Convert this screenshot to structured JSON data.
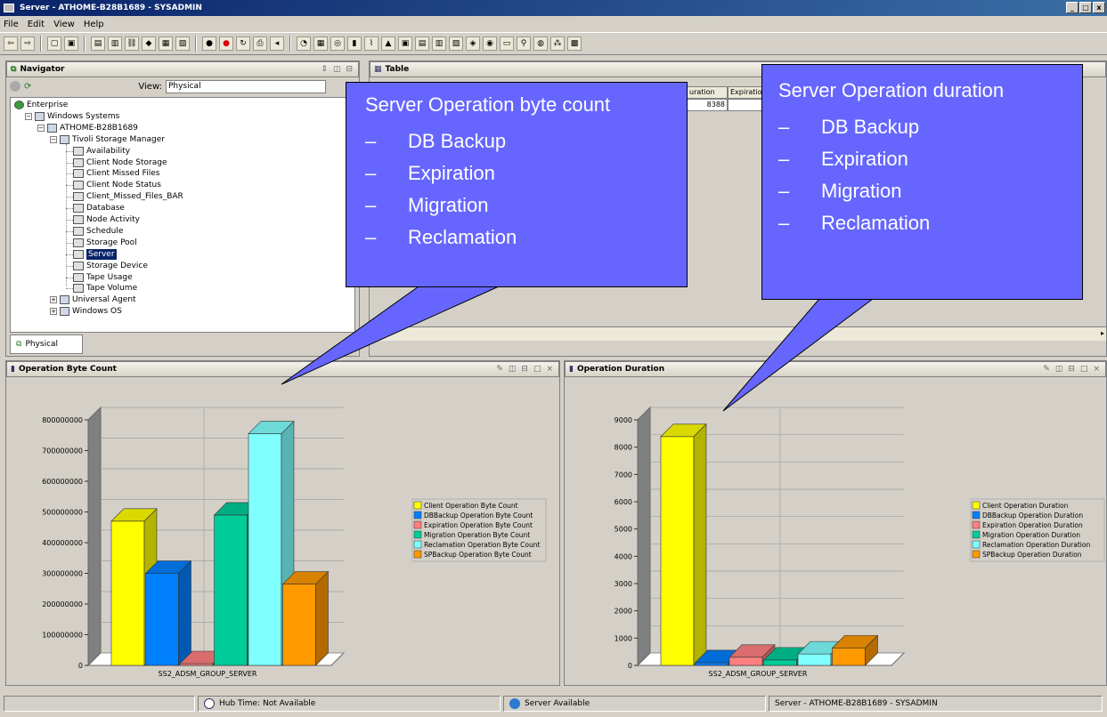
{
  "window": {
    "title": "Server - ATHOME-B28B1689 - SYSADMIN",
    "min": "_",
    "max": "□",
    "close": "x"
  },
  "menu": [
    "File",
    "Edit",
    "View",
    "Help"
  ],
  "navigator": {
    "title": "Navigator",
    "view_label": "View:",
    "view_value": "Physical",
    "tab_label": "Physical",
    "tree": [
      {
        "label": "Enterprise",
        "level": 0,
        "icon": "globe-icon"
      },
      {
        "label": "Windows Systems",
        "level": 1,
        "icon": "folder-icon"
      },
      {
        "label": "ATHOME-B28B1689",
        "level": 2,
        "icon": "computer-icon"
      },
      {
        "label": "Tivoli Storage Manager",
        "level": 3,
        "icon": "agent-icon"
      },
      {
        "label": "Availability",
        "level": 4,
        "icon": "workspace-icon"
      },
      {
        "label": "Client Node Storage",
        "level": 4,
        "icon": "workspace-icon"
      },
      {
        "label": "Client Missed Files",
        "level": 4,
        "icon": "workspace-icon"
      },
      {
        "label": "Client Node Status",
        "level": 4,
        "icon": "workspace-icon"
      },
      {
        "label": "Client_Missed_Files_BAR",
        "level": 4,
        "icon": "workspace-icon"
      },
      {
        "label": "Database",
        "level": 4,
        "icon": "workspace-icon"
      },
      {
        "label": "Node Activity",
        "level": 4,
        "icon": "workspace-icon"
      },
      {
        "label": "Schedule",
        "level": 4,
        "icon": "workspace-icon"
      },
      {
        "label": "Storage Pool",
        "level": 4,
        "icon": "workspace-icon"
      },
      {
        "label": "Server",
        "level": 4,
        "icon": "workspace-icon",
        "selected": true
      },
      {
        "label": "Storage Device",
        "level": 4,
        "icon": "workspace-icon"
      },
      {
        "label": "Tape Usage",
        "level": 4,
        "icon": "workspace-icon"
      },
      {
        "label": "Tape Volume",
        "level": 4,
        "icon": "workspace-icon"
      },
      {
        "label": "Universal Agent",
        "level": 3,
        "icon": "agent-icon"
      },
      {
        "label": "Windows OS",
        "level": 3,
        "icon": "agent-icon"
      }
    ]
  },
  "table": {
    "title": "Table",
    "headers": [
      "uration",
      "Expiration"
    ],
    "values": [
      "8388",
      ""
    ]
  },
  "callouts": {
    "left": {
      "title": "Server Operation byte count",
      "dash": "–",
      "items": [
        "DB Backup",
        "Expiration",
        "Migration",
        "Reclamation"
      ]
    },
    "right": {
      "title": "Server Operation duration",
      "dash": "–",
      "items": [
        "DB Backup",
        "Expiration",
        "Migration",
        "Reclamation"
      ]
    }
  },
  "chart_data": [
    {
      "type": "bar",
      "title": "Operation Byte Count",
      "categories": [
        "SS2_ADSM_GROUP_SERVER"
      ],
      "series": [
        {
          "name": "Client Operation Byte Count",
          "values": [
            470000000
          ],
          "color": "#ffff00"
        },
        {
          "name": "DBBackup Operation Byte Count",
          "values": [
            300000000
          ],
          "color": "#0080ff"
        },
        {
          "name": "Expiration Operation Byte Count",
          "values": [
            0
          ],
          "color": "#ff8080"
        },
        {
          "name": "Migration Operation Byte Count",
          "values": [
            490000000
          ],
          "color": "#00cc99"
        },
        {
          "name": "Reclamation Operation Byte Count",
          "values": [
            755000000
          ],
          "color": "#80ffff"
        },
        {
          "name": "SPBackup Operation Byte Count",
          "values": [
            265000000
          ],
          "color": "#ff9900"
        }
      ],
      "yticks": [
        "0",
        "100000000",
        "200000000",
        "300000000",
        "400000000",
        "500000000",
        "600000000",
        "700000000",
        "800000000"
      ],
      "ylim": [
        0,
        800000000
      ],
      "legend": "right"
    },
    {
      "type": "bar",
      "title": "Operation Duration",
      "categories": [
        "SS2_ADSM_GROUP_SERVER"
      ],
      "series": [
        {
          "name": "Client Operation Duration",
          "values": [
            8388
          ],
          "color": "#ffff00"
        },
        {
          "name": "DBBackup Operation Duration",
          "values": [
            100
          ],
          "color": "#0080ff"
        },
        {
          "name": "Expiration Operation Duration",
          "values": [
            300
          ],
          "color": "#ff8080"
        },
        {
          "name": "Migration Operation Duration",
          "values": [
            200
          ],
          "color": "#00cc99"
        },
        {
          "name": "Reclamation Operation Duration",
          "values": [
            420
          ],
          "color": "#80ffff"
        },
        {
          "name": "SPBackup Operation Duration",
          "values": [
            640
          ],
          "color": "#ff9900"
        }
      ],
      "yticks": [
        "0",
        "1000",
        "2000",
        "3000",
        "4000",
        "5000",
        "6000",
        "7000",
        "8000",
        "9000"
      ],
      "ylim": [
        0,
        9000
      ],
      "legend": "right"
    }
  ],
  "status": {
    "hub_time": "Hub Time: Not Available",
    "server": "Server Available",
    "session": "Server - ATHOME-B28B1689 - SYSADMIN"
  }
}
